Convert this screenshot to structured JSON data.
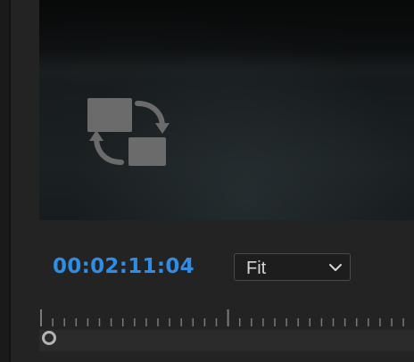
{
  "program_monitor": {
    "timecode": "00:02:11:04",
    "zoom": {
      "selected": "Fit",
      "icon": "chevron-down-icon"
    },
    "overlay_icon": "flip-swap-icon",
    "colors": {
      "timecode": "#2e8ee6",
      "background": "#232323",
      "icon_gray": "#6b6b6b"
    }
  }
}
